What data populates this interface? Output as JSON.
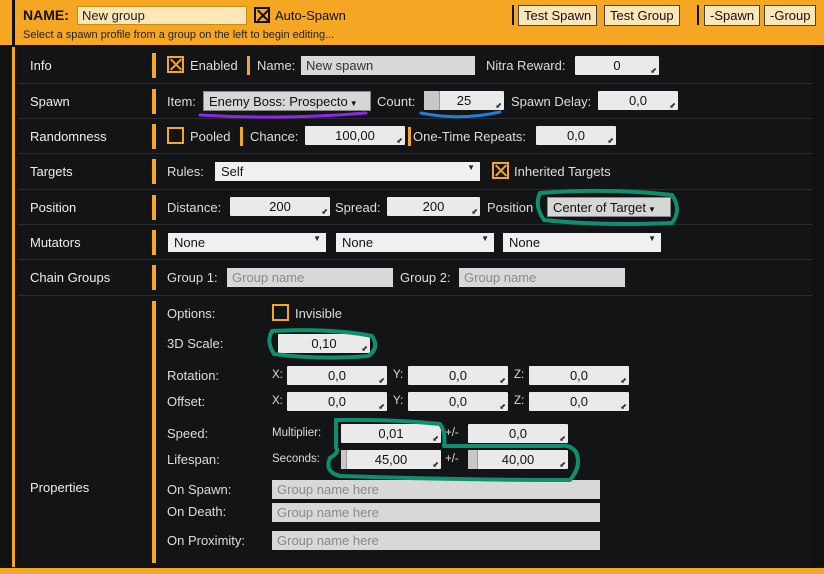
{
  "header": {
    "name_label": "NAME:",
    "name_value": "New group",
    "auto_spawn_label": "Auto-Spawn",
    "hint": "Select a spawn profile from a group on the left to begin editing...",
    "buttons": {
      "test_spawn": "Test Spawn",
      "test_group": "Test Group",
      "minus_spawn": "-Spawn",
      "minus_group": "-Group"
    }
  },
  "rows": {
    "info": "Info",
    "spawn": "Spawn",
    "randomness": "Randomness",
    "targets": "Targets",
    "position": "Position",
    "mutators": "Mutators",
    "chain_groups": "Chain Groups",
    "properties": "Properties"
  },
  "info": {
    "enabled_label": "Enabled",
    "name_label": "Name:",
    "name_value": "New spawn",
    "nitra_label": "Nitra Reward:",
    "nitra_value": "0"
  },
  "spawn": {
    "item_label": "Item:",
    "item_value": "Enemy Boss: Prospecto",
    "count_label": "Count:",
    "count_value": "25",
    "delay_label": "Spawn Delay:",
    "delay_value": "0,0"
  },
  "randomness": {
    "pooled_label": "Pooled",
    "chance_label": "Chance:",
    "chance_value": "100,00",
    "repeats_label": "One-Time Repeats:",
    "repeats_value": "0,0"
  },
  "targets": {
    "rules_label": "Rules:",
    "rules_value": "Self",
    "inherited_label": "Inherited Targets"
  },
  "position": {
    "distance_label": "Distance:",
    "distance_value": "200",
    "spread_label": "Spread:",
    "spread_value": "200",
    "position_label": "Position",
    "position_value": "Center of Target"
  },
  "mutators": {
    "m1": "None",
    "m2": "None",
    "m3": "None"
  },
  "chain": {
    "group1_label": "Group 1:",
    "group1_placeholder": "Group name",
    "group2_label": "Group 2:",
    "group2_placeholder": "Group name"
  },
  "properties": {
    "options_label": "Options:",
    "invisible_label": "Invisible",
    "scale_label": "3D Scale:",
    "scale_value": "0,10",
    "rotation_label": "Rotation:",
    "offset_label": "Offset:",
    "x": "X:",
    "y": "Y:",
    "z": "Z:",
    "rotation": {
      "x": "0,0",
      "y": "0,0",
      "z": "0,0"
    },
    "offset": {
      "x": "0,0",
      "y": "0,0",
      "z": "0,0"
    },
    "speed_label": "Speed:",
    "multiplier_label": "Multiplier:",
    "speed_value": "0,01",
    "plusminus": "+/-",
    "speed_pm_value": "0,0",
    "lifespan_label": "Lifespan:",
    "seconds_label": "Seconds:",
    "lifespan_value": "45,00",
    "lifespan_pm_value": "40,00",
    "on_spawn_label": "On Spawn:",
    "on_death_label": "On Death:",
    "on_proximity_label": "On Proximity:",
    "group_placeholder": "Group name here"
  },
  "colors": {
    "accent": "#f5a623",
    "annotation_green": "#0f8f6e",
    "annotation_purple": "#8a2be2",
    "annotation_blue": "#1e7fd8"
  }
}
